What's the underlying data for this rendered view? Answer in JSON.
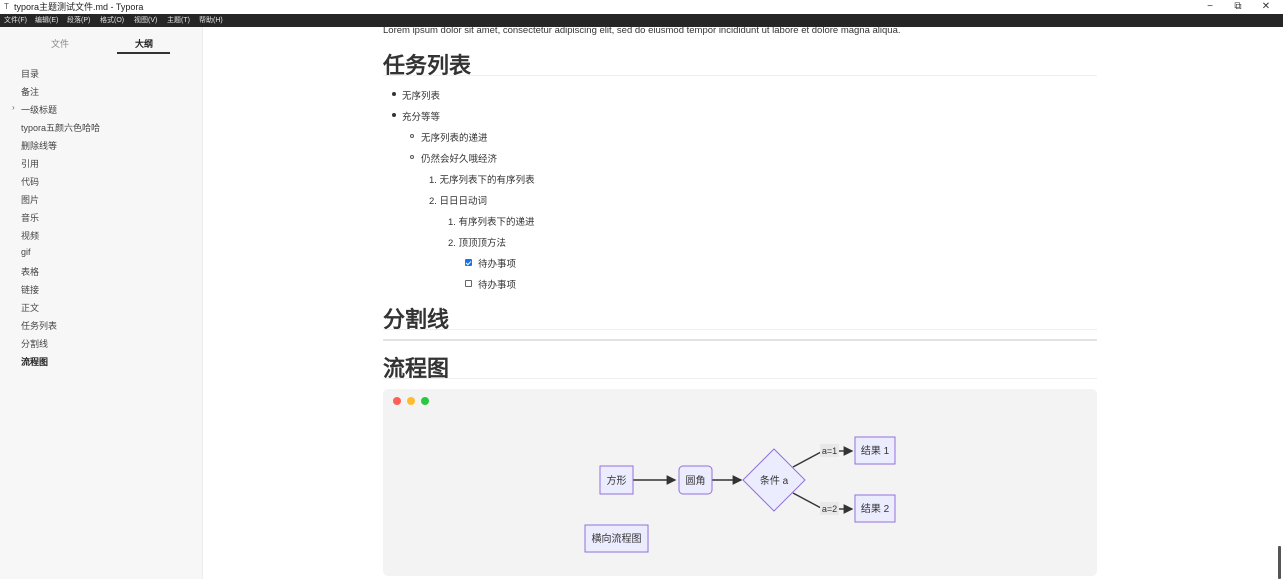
{
  "window": {
    "title": "typora主题测试文件.md - Typora",
    "controls": {
      "minimize": "−",
      "restore": "⧉",
      "close": "✕"
    }
  },
  "menu": [
    "文件(F)",
    "编辑(E)",
    "段落(P)",
    "格式(O)",
    "视图(V)",
    "主题(T)",
    "帮助(H)"
  ],
  "sidebar": {
    "tabs": [
      {
        "label": "文件",
        "active": false
      },
      {
        "label": "大纲",
        "active": true
      }
    ],
    "outline": [
      {
        "label": "目录"
      },
      {
        "label": "备注"
      },
      {
        "label": "一级标题",
        "collapsible": true
      },
      {
        "label": "typora五颜六色哈哈"
      },
      {
        "label": "删除线等"
      },
      {
        "label": "引用"
      },
      {
        "label": "代码"
      },
      {
        "label": "图片"
      },
      {
        "label": "音乐"
      },
      {
        "label": "视频"
      },
      {
        "label": "gif"
      },
      {
        "label": "表格"
      },
      {
        "label": "链接"
      },
      {
        "label": "正文"
      },
      {
        "label": "任务列表"
      },
      {
        "label": "分割线"
      },
      {
        "label": "流程图",
        "active": true
      }
    ]
  },
  "content": {
    "lorem": "Lorem ipsum dolor sit amet, consectetur adipiscing elit, sed do eiusmod tempor incididunt ut labore et dolore magna aliqua.",
    "h_tasks": "任务列表",
    "list": {
      "ul1": "无序列表",
      "ul2": "充分等等",
      "sub1": "无序列表的递进",
      "sub2": "仍然会好久哦经济",
      "ol1": "1. 无序列表下的有序列表",
      "ol2": "2. 日日日动词",
      "ol3": "1. 有序列表下的递进",
      "ol4": "2. 顶顶顶方法",
      "task1": {
        "label": "待办事项",
        "checked": true
      },
      "task2": {
        "label": "待办事项",
        "checked": false
      }
    },
    "h_divider": "分割线",
    "h_flow": "流程图"
  },
  "flowchart": {
    "window_dots": [
      "#ff5f56",
      "#ffbd2e",
      "#27c93f"
    ],
    "nodes": {
      "rect": "方形",
      "round": "圆角",
      "cond": "条件 a",
      "res1": "结果 1",
      "res2": "结果 2",
      "horiz": "横向流程图"
    },
    "edge_labels": {
      "e1": "a=1",
      "e2": "a=2"
    },
    "colors": {
      "node_fill": "#ECECFF",
      "node_stroke": "#9370DB",
      "edge": "#333333",
      "label_bg": "#e8e8e8"
    }
  }
}
